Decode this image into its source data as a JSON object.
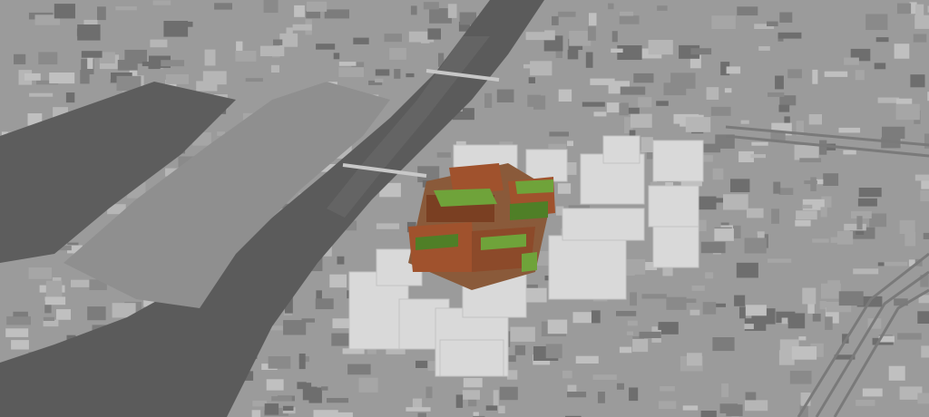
{
  "image": {
    "subject": "aerial-urban-masterplan-render",
    "palette": {
      "background": "#8c8c8c",
      "land": "#9b9b9b",
      "water": "#5b5b5b",
      "waterHighlight": "#6a6a6a",
      "blockDark": "#6e6e6e",
      "blockLight": "#b2b2b2",
      "massing": "#d9d9d9",
      "massingShade": "#c3c3c3",
      "brick": "#a0522d",
      "brickDark": "#7a3f22",
      "greenRoof": "#6fa33a",
      "greenRoofDark": "#4f7f27",
      "rail": "#7a7a7a"
    }
  }
}
